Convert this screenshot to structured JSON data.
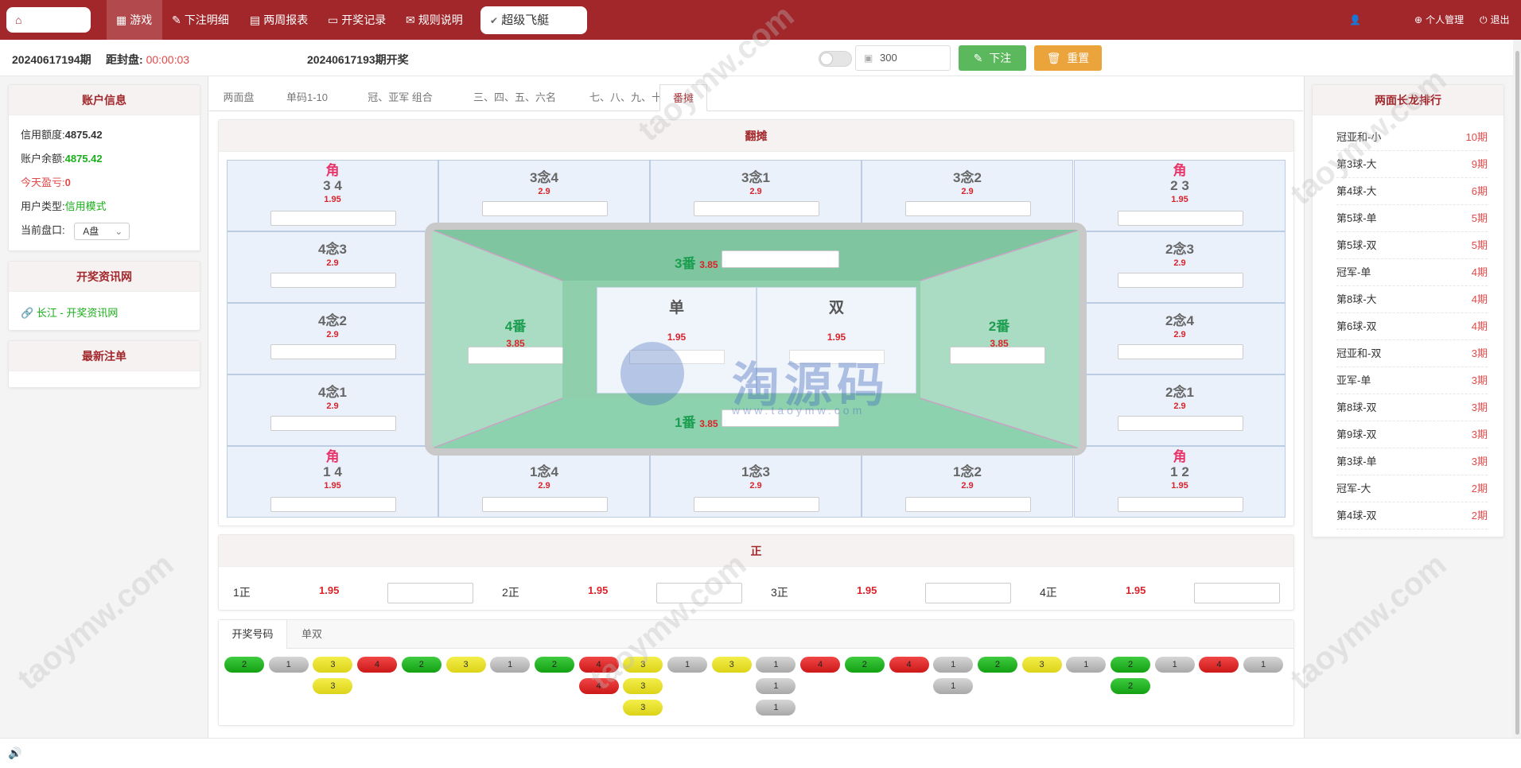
{
  "topbar": {
    "home_icon": "home-icon",
    "nav": [
      {
        "label": "游戏",
        "icon": "grid-icon"
      },
      {
        "label": "下注明细",
        "icon": "pen-icon"
      },
      {
        "label": "两周报表",
        "icon": "table-icon"
      },
      {
        "label": "开奖记录",
        "icon": "monitor-icon"
      },
      {
        "label": "规则说明",
        "icon": "chat-icon"
      }
    ],
    "game_title": "超级飞艇",
    "user_label": "个人管理",
    "logout_label": "退出"
  },
  "subbar": {
    "current_period": "20240617194期",
    "close_label": "距封盘:",
    "countdown": "00:00:03",
    "last_draw": "20240617193期开奖",
    "amount": "300",
    "bet_label": "下注",
    "reset_label": "重置"
  },
  "account": {
    "title": "账户信息",
    "credit_label": "信用额度:",
    "credit_value": "4875.42",
    "balance_label": "账户余额:",
    "balance_value": "4875.42",
    "profit_label": "今天盈亏:",
    "profit_value": "0",
    "type_label": "用户类型:",
    "type_value": "信用模式",
    "plate_label": "当前盘口:",
    "plate_value": "A盘"
  },
  "news": {
    "title": "开奖资讯网",
    "link": "长江 - 开奖资讯网"
  },
  "latest": {
    "title": "最新注单"
  },
  "tabs": [
    "两面盘",
    "单码1-10",
    "冠、亚军 组合",
    "三、四、五、六名",
    "七、八、九、十名",
    "番摊"
  ],
  "fantan": {
    "title": "翻摊",
    "jiao_label": "角",
    "cells": {
      "c34": {
        "label": "3 4",
        "odd": "1.95"
      },
      "c3n4": {
        "label": "3念4",
        "odd": "2.9"
      },
      "c3n1": {
        "label": "3念1",
        "odd": "2.9"
      },
      "c3n2": {
        "label": "3念2",
        "odd": "2.9"
      },
      "c23": {
        "label": "2 3",
        "odd": "1.95"
      },
      "c4n3": {
        "label": "4念3",
        "odd": "2.9"
      },
      "c2n3": {
        "label": "2念3",
        "odd": "2.9"
      },
      "c4n2": {
        "label": "4念2",
        "odd": "2.9"
      },
      "c2n4": {
        "label": "2念4",
        "odd": "2.9"
      },
      "c4n1": {
        "label": "4念1",
        "odd": "2.9"
      },
      "c2n1": {
        "label": "2念1",
        "odd": "2.9"
      },
      "c14": {
        "label": "1 4",
        "odd": "1.95"
      },
      "c1n4": {
        "label": "1念4",
        "odd": "2.9"
      },
      "c1n3": {
        "label": "1念3",
        "odd": "2.9"
      },
      "c1n2": {
        "label": "1念2",
        "odd": "2.9"
      },
      "c12": {
        "label": "1 2",
        "odd": "1.95"
      }
    },
    "fan3": {
      "label": "3番",
      "odd": "3.85"
    },
    "fan4": {
      "label": "4番",
      "odd": "3.85"
    },
    "fan2": {
      "label": "2番",
      "odd": "3.85"
    },
    "fan1": {
      "label": "1番",
      "odd": "3.85"
    },
    "dan": {
      "label": "单",
      "odd": "1.95"
    },
    "shuang": {
      "label": "双",
      "odd": "1.95"
    }
  },
  "zheng": {
    "title": "正",
    "items": [
      {
        "label": "1正",
        "odd": "1.95"
      },
      {
        "label": "2正",
        "odd": "1.95"
      },
      {
        "label": "3正",
        "odd": "1.95"
      },
      {
        "label": "4正",
        "odd": "1.95"
      }
    ]
  },
  "results": {
    "tabs": [
      "开奖号码",
      "单双"
    ],
    "columns": [
      [
        "2"
      ],
      [
        "1"
      ],
      [
        "3",
        "3"
      ],
      [
        "4"
      ],
      [
        "2"
      ],
      [
        "3"
      ],
      [
        "1"
      ],
      [
        "2"
      ],
      [
        "4",
        "4"
      ],
      [
        "3",
        "3",
        "3"
      ],
      [
        "1"
      ],
      [
        "3"
      ],
      [
        "1",
        "1",
        "1"
      ],
      [
        "4"
      ],
      [
        "2"
      ],
      [
        "4"
      ],
      [
        "1",
        "1"
      ],
      [
        "2"
      ],
      [
        "3"
      ],
      [
        "1"
      ],
      [
        "2",
        "2"
      ],
      [
        "1"
      ],
      [
        "4"
      ],
      [
        "1"
      ]
    ],
    "colors": {
      "1": "#b5b5b5",
      "2": "#1eb41e",
      "3": "#eee32c",
      "4": "#e02a2a"
    }
  },
  "ranking": {
    "title": "两面长龙排行",
    "items": [
      {
        "name": "冠亚和-小",
        "count": "10期"
      },
      {
        "name": "第3球-大",
        "count": "9期"
      },
      {
        "name": "第4球-大",
        "count": "6期"
      },
      {
        "name": "第5球-单",
        "count": "5期"
      },
      {
        "name": "第5球-双",
        "count": "5期"
      },
      {
        "name": "冠军-单",
        "count": "4期"
      },
      {
        "name": "第8球-大",
        "count": "4期"
      },
      {
        "name": "第6球-双",
        "count": "4期"
      },
      {
        "name": "冠亚和-双",
        "count": "3期"
      },
      {
        "name": "亚军-单",
        "count": "3期"
      },
      {
        "name": "第8球-双",
        "count": "3期"
      },
      {
        "name": "第9球-双",
        "count": "3期"
      },
      {
        "name": "第3球-单",
        "count": "3期"
      },
      {
        "name": "冠军-大",
        "count": "2期"
      },
      {
        "name": "第4球-双",
        "count": "2期"
      }
    ]
  },
  "watermark": {
    "text": "taoymw.com",
    "logo_text": "淘源码",
    "logo_sub": "www.taoymw.com"
  }
}
